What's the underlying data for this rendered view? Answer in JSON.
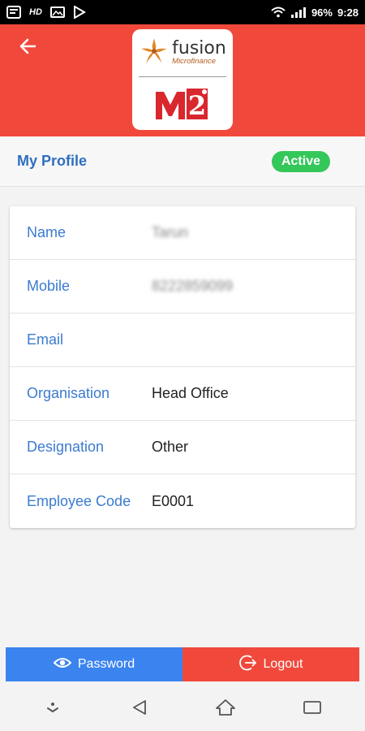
{
  "status_bar": {
    "hd_label": "HD",
    "battery": "96%",
    "time": "9:28"
  },
  "header": {
    "logo": {
      "brand": "fusion",
      "tagline": "Microfinance",
      "mark": "M2i"
    }
  },
  "profile_bar": {
    "title": "My Profile",
    "status": "Active"
  },
  "profile_rows": [
    {
      "label": "Name",
      "value": "Tarun",
      "blurred": true
    },
    {
      "label": "Mobile",
      "value": "8222859099",
      "blurred": true
    },
    {
      "label": "Email",
      "value": ""
    },
    {
      "label": "Organisation",
      "value": "Head Office"
    },
    {
      "label": "Designation",
      "value": "Other"
    },
    {
      "label": "Employee Code",
      "value": "E0001"
    }
  ],
  "buttons": {
    "password": "Password",
    "logout": "Logout"
  },
  "colors": {
    "header": "#f0493c",
    "accent_blue": "#2f6fc0",
    "badge_green": "#34c759",
    "password_btn": "#3b84f0",
    "logout_btn": "#f0493c"
  },
  "icons": [
    "notes-icon",
    "hd-icon",
    "image-icon",
    "play-store-icon",
    "wifi-icon",
    "signal-icon",
    "back-arrow-icon",
    "eye-icon",
    "logout-icon",
    "nav-hide-icon",
    "nav-back-icon",
    "nav-home-icon",
    "nav-recents-icon"
  ]
}
